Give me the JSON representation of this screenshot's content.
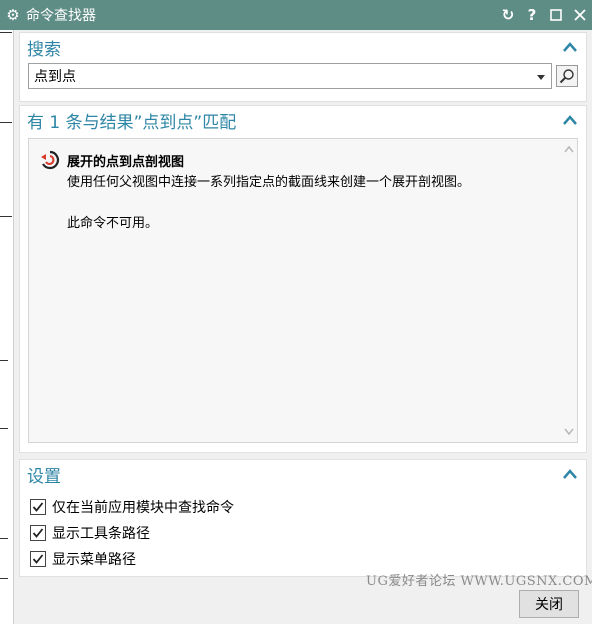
{
  "window": {
    "title": "命令查找器"
  },
  "search": {
    "section_title": "搜索",
    "value": "点到点"
  },
  "results": {
    "section_title": "有 1 条与结果”点到点”匹配",
    "items": [
      {
        "title": "展开的点到点剖视图",
        "description": "使用任何父视图中连接一系列指定点的截面线来创建一个展开剖视图。",
        "status": "此命令不可用。"
      }
    ]
  },
  "settings": {
    "section_title": "设置",
    "options": [
      {
        "label": "仅在当前应用模块中查找命令",
        "checked": true
      },
      {
        "label": "显示工具条路径",
        "checked": true
      },
      {
        "label": "显示菜单路径",
        "checked": true
      }
    ]
  },
  "footer": {
    "close_label": "关闭",
    "watermark": "UG爱好者论坛 WWW.UGSNX.COM"
  },
  "colors": {
    "titlebar": "#5e8d86",
    "section_title": "#2e86a6"
  }
}
